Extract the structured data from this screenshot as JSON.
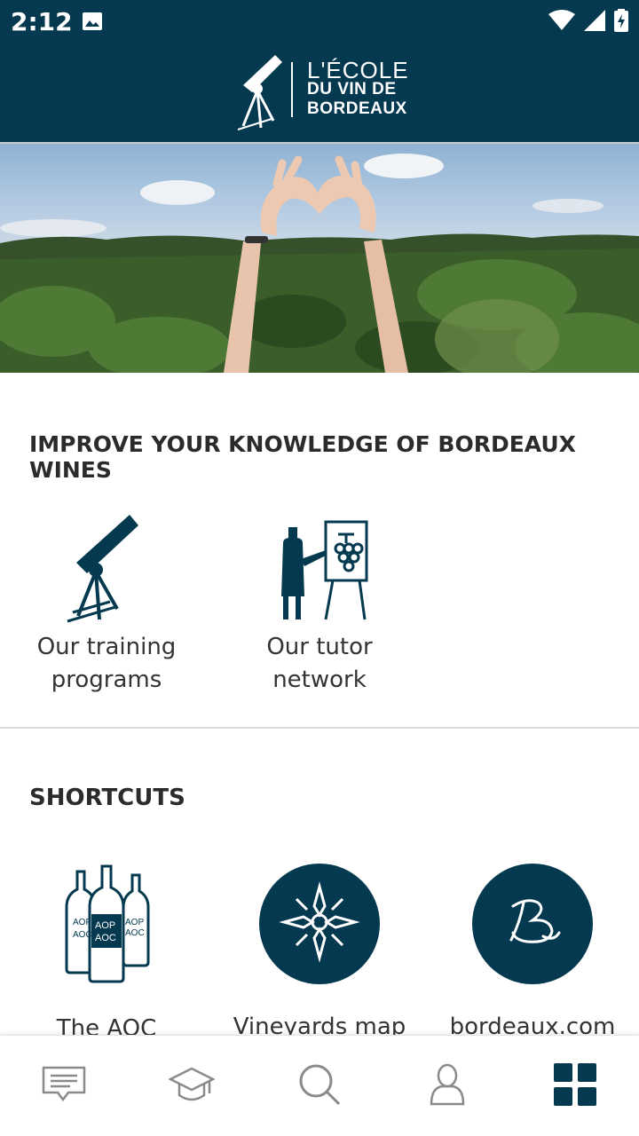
{
  "status_bar": {
    "time": "2:12"
  },
  "header": {
    "logo_line1": "L'ÉCOLE",
    "logo_line2": "DU VIN DE",
    "logo_line3": "BORDEAUX",
    "logo_icon": "telescope-icon",
    "background_color": "#04394f"
  },
  "hero": {
    "image_desc_icon": "vineyard-heart-hands-photo"
  },
  "knowledge_section": {
    "title": "IMPROVE YOUR KNOWLEDGE OF BORDEAUX WINES",
    "items": [
      {
        "line1": "Our training",
        "line2": "programs",
        "icon": "telescope-icon"
      },
      {
        "line1": "Our tutor",
        "line2": "network",
        "icon": "tutor-board-icon"
      }
    ]
  },
  "shortcuts_section": {
    "title": "SHORTCUTS",
    "items": [
      {
        "label": "The AOC",
        "icon": "aoc-bottles-icon",
        "bottle_label_top": "AOP",
        "bottle_label_bottom": "AOC"
      },
      {
        "label": "Vineyards map",
        "icon": "compass-rose-icon"
      },
      {
        "label": "bordeaux.com",
        "icon": "bordeaux-b-icon"
      }
    ]
  },
  "bottom_nav": {
    "items": [
      {
        "icon": "messages-icon",
        "active": false
      },
      {
        "icon": "graduation-cap-icon",
        "active": false
      },
      {
        "icon": "search-icon",
        "active": false
      },
      {
        "icon": "profile-icon",
        "active": false
      },
      {
        "icon": "grid-icon",
        "active": true
      }
    ],
    "active_color": "#04394f",
    "inactive_color": "#8a8a8a"
  }
}
